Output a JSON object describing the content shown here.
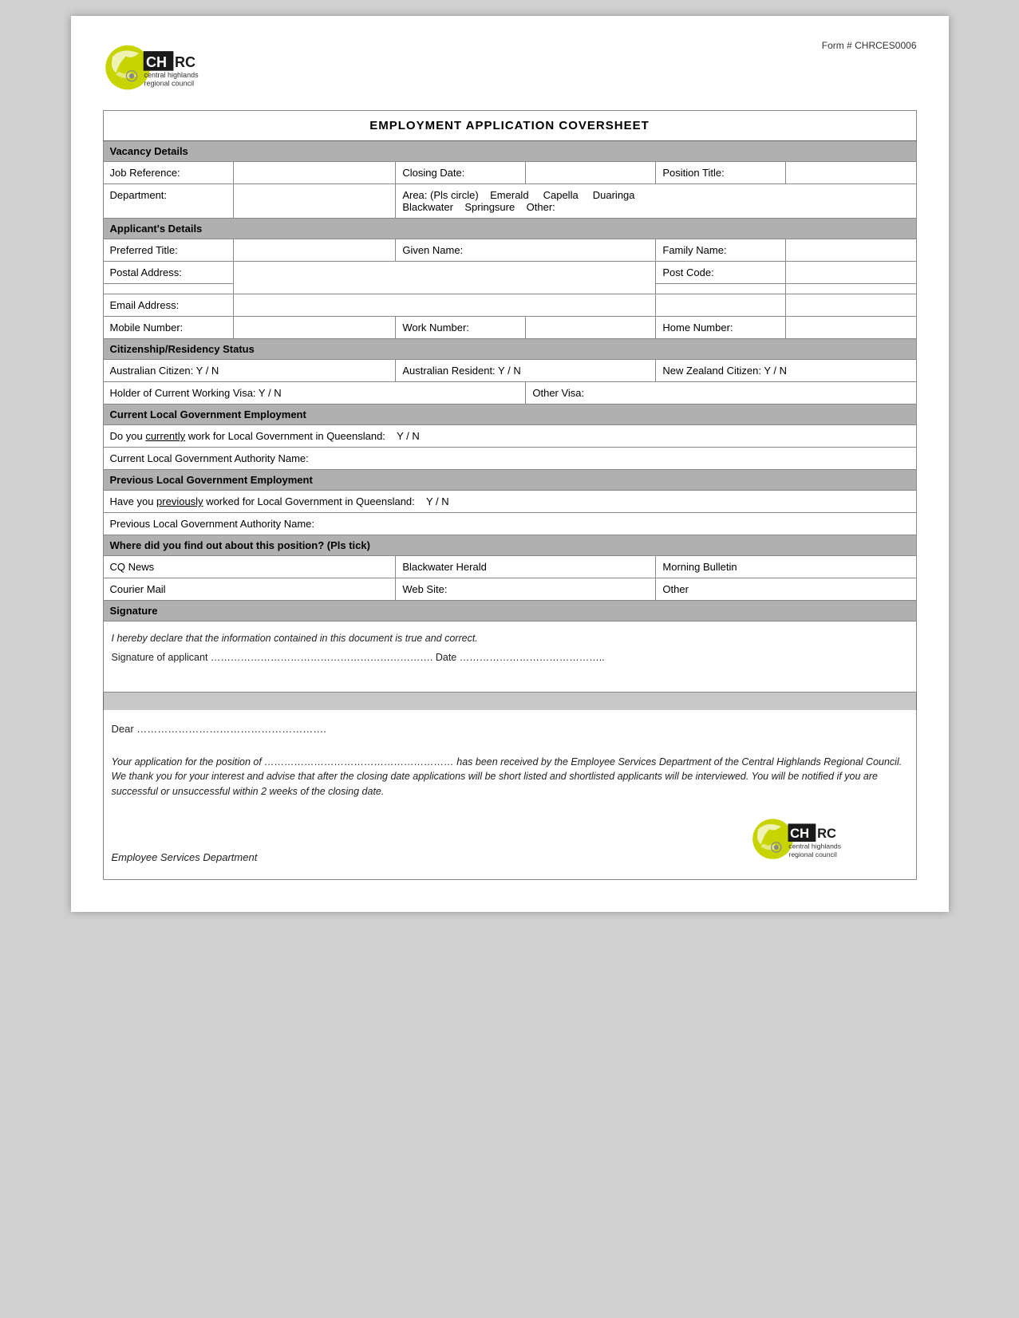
{
  "form_number": "Form # CHRCES0006",
  "title": "EMPLOYMENT APPLICATION COVERSHEET",
  "sections": {
    "vacancy_details": {
      "header": "Vacancy Details",
      "job_reference_label": "Job Reference:",
      "closing_date_label": "Closing Date:",
      "position_title_label": "Position Title:",
      "department_label": "Department:",
      "area_label": "Area: (Pls circle)",
      "area_options": "Emerald    Capella    Duaringa    Blackwater    Springsure    Other:"
    },
    "applicants_details": {
      "header": "Applicant's Details",
      "preferred_title_label": "Preferred Title:",
      "given_name_label": "Given Name:",
      "family_name_label": "Family Name:",
      "postal_address_label": "Postal Address:",
      "post_code_label": "Post Code:",
      "email_address_label": "Email Address:",
      "mobile_number_label": "Mobile Number:",
      "work_number_label": "Work Number:",
      "home_number_label": "Home Number:"
    },
    "citizenship": {
      "header": "Citizenship/Residency Status",
      "australian_citizen": "Australian Citizen:  Y / N",
      "australian_resident": "Australian Resident:  Y / N",
      "nz_citizen": "New Zealand Citizen:  Y / N",
      "holder_working_visa": "Holder of Current Working Visa: Y / N",
      "other_visa": "Other Visa:"
    },
    "current_employment": {
      "header": "Current Local Government Employment",
      "currently_label": "Do you",
      "currently_underline": "currently",
      "currently_rest": "work for Local Government in Queensland:   Y / N",
      "authority_label": "Current Local Government Authority Name:"
    },
    "previous_employment": {
      "header": "Previous Local Government Employment",
      "previously_label": "Have you",
      "previously_underline": "previously",
      "previously_rest": "worked for Local Government in Queensland:   Y / N",
      "authority_label": "Previous Local Government Authority Name:"
    },
    "find_out": {
      "header": "Where did you find out about this position? (Pls tick)",
      "col1_row1": "CQ News",
      "col2_row1": "Blackwater Herald",
      "col3_row1": "Morning Bulletin",
      "col1_row2": "Courier Mail",
      "col2_row2": "Web Site:",
      "col3_row2": "Other"
    },
    "signature": {
      "header": "Signature",
      "declaration": "I hereby declare that the information contained in this document is true and correct.",
      "sig_line": "Signature of applicant ………………………………………………………….   Date …………………………………….."
    }
  },
  "letter": {
    "dear": "Dear ……………………………………………….",
    "body": "Your application for the position of ………………………………………………… has been received by the Employee Services Department of the Central Highlands Regional Council. We thank you for your interest and advise that after the closing date applications will be short listed and shortlisted applicants will be interviewed. You will be notified if you are successful or unsuccessful within 2 weeks of the closing date.",
    "footer": "Employee Services Department"
  },
  "logo": {
    "chrc_text": "CH",
    "rc_text": "RC",
    "tagline1": "central highlands",
    "tagline2": "regional council",
    "form_number": "Form # CHRCES0006"
  }
}
